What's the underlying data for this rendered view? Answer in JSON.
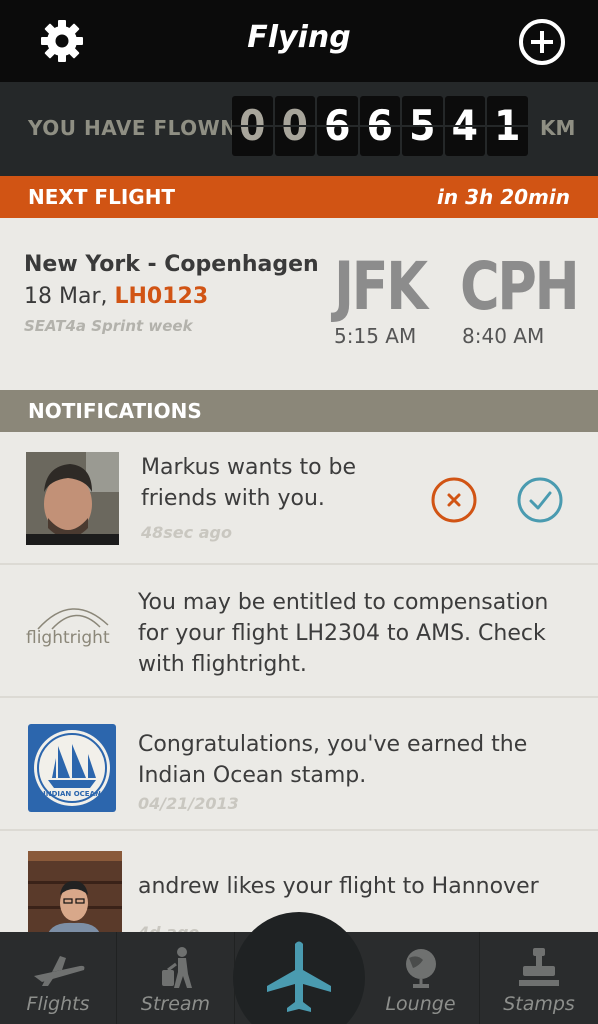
{
  "header": {
    "title": "Flying",
    "settings_icon": "gear-icon",
    "add_icon": "plus-circle-icon"
  },
  "odometer": {
    "label": "YOU HAVE FLOWN",
    "digits": [
      "0",
      "0",
      "6",
      "6",
      "5",
      "4",
      "1"
    ],
    "unit": "KM"
  },
  "next_flight": {
    "label": "NEXT FLIGHT",
    "countdown": "in 3h 20min",
    "route": "New York - Copenhagen",
    "date": "18 Mar,",
    "flight_number": "LH0123",
    "seat_note": "SEAT4a Sprint week",
    "origin": {
      "code": "JFK",
      "time": "5:15 AM"
    },
    "destination": {
      "code": "CPH",
      "time": "8:40 AM"
    }
  },
  "notifications": {
    "label": "NOTIFICATIONS",
    "items": [
      {
        "line1": "Markus wants to be",
        "line2": "friends with you.",
        "time": "48sec ago"
      },
      {
        "line1": "You may be entitled to compensation",
        "line2": "for your flight LH2304 to AMS. Check",
        "line3": "with flightright.",
        "logo_text": "flightright"
      },
      {
        "line1": "Congratulations, you've earned the",
        "line2": "Indian Ocean stamp.",
        "time": "04/21/2013",
        "stamp_text": "INDIAN OCEAN"
      },
      {
        "line1": "andrew likes your flight to Hannover",
        "time": "4d ago"
      }
    ]
  },
  "tabs": [
    {
      "label": "Flights",
      "icon": "plane-icon"
    },
    {
      "label": "Stream",
      "icon": "traveler-icon"
    },
    {
      "label": "",
      "icon": "plane-icon"
    },
    {
      "label": "Lounge",
      "icon": "globe-icon"
    },
    {
      "label": "Stamps",
      "icon": "stamp-icon"
    }
  ],
  "colors": {
    "accent": "#d15414",
    "header": "#0b0b0b",
    "section": "#8b8779",
    "decline": "#d15414",
    "accept": "#4a9bb0"
  }
}
